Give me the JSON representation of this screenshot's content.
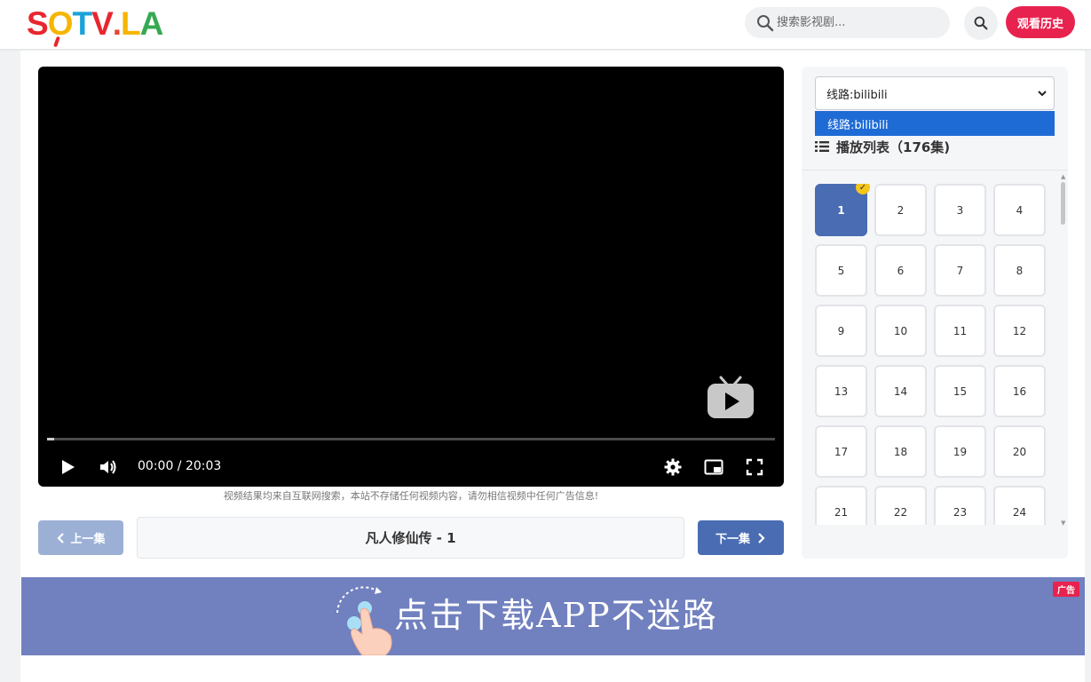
{
  "header": {
    "logo": [
      "S",
      "O",
      "T",
      "V",
      ".",
      "L",
      "A"
    ],
    "search_placeholder": "搜索影视剧...",
    "history_label": "观看历史"
  },
  "player": {
    "time_display": "00:00 / 20:03",
    "progress": 0.01
  },
  "disclaimer": "视频结果均来自互联网搜索，本站不存储任何视频内容，请勿相信视频中任何广告信息!",
  "nav": {
    "prev_label": "上一集",
    "title": "凡人修仙传 - 1",
    "next_label": "下一集"
  },
  "sidebar": {
    "route_selected": "线路:bilibili",
    "route_options": [
      "线路:bilibili"
    ],
    "playlist_title": "播放列表（176集)",
    "active_episode": "1",
    "episodes": [
      "1",
      "2",
      "3",
      "4",
      "5",
      "6",
      "7",
      "8",
      "9",
      "10",
      "11",
      "12",
      "13",
      "14",
      "15",
      "16",
      "17",
      "18",
      "19",
      "20",
      "21",
      "22",
      "23",
      "24"
    ]
  },
  "ad": {
    "text": "点击下载APP不迷路",
    "tag": "广告"
  },
  "colors": {
    "accent_blue": "#4a6cb3",
    "accent_red": "#e8224e",
    "ad_bg": "#7180be"
  }
}
